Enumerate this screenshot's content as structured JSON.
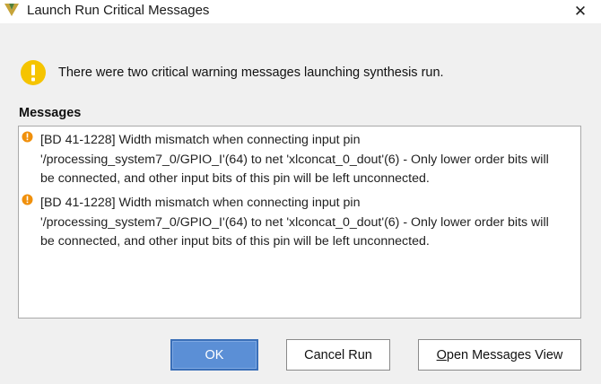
{
  "window": {
    "title": "Launch Run Critical Messages",
    "close_glyph": "✕"
  },
  "summary": "There were two critical warning messages launching synthesis run.",
  "messages_header": "Messages",
  "messages": [
    {
      "icon": "critical-warning-icon",
      "line1": "[BD 41-1228] Width mismatch when connecting input pin",
      "line2": "'/processing_system7_0/GPIO_I'(64) to net 'xlconcat_0_dout'(6) - Only lower order bits will",
      "line3": "be connected, and other input bits of this pin will be left unconnected."
    },
    {
      "icon": "critical-warning-icon",
      "line1": "[BD 41-1228] Width mismatch when connecting input pin",
      "line2": "'/processing_system7_0/GPIO_I'(64) to net 'xlconcat_0_dout'(6) - Only lower order bits will",
      "line3": "be connected, and other input bits of this pin will be left unconnected."
    }
  ],
  "buttons": {
    "ok": "OK",
    "cancel_run": "Cancel Run",
    "open_messages_first": "O",
    "open_messages_rest": "pen Messages View"
  },
  "colors": {
    "warning": "#f5a623",
    "ok_button": "#5b8fd6",
    "logo": "#c6a43a"
  }
}
